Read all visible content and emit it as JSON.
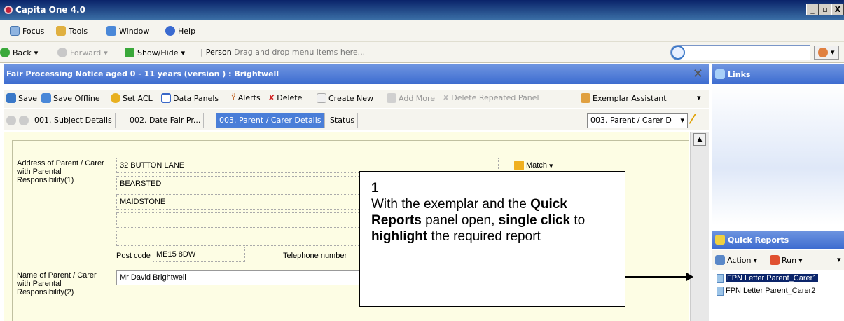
{
  "window": {
    "title": "Capita One 4.0",
    "min_btn": "_",
    "max_btn": "▫",
    "close_btn": "X"
  },
  "menubar": {
    "items": [
      {
        "label": "Focus",
        "icon": "focus-icon"
      },
      {
        "label": "Tools",
        "icon": "tools-icon"
      },
      {
        "label": "Window",
        "icon": "window-icon"
      },
      {
        "label": "Help",
        "icon": "help-icon"
      }
    ]
  },
  "navbar": {
    "back": "Back",
    "forward": "Forward",
    "show_hide": "Show/Hide",
    "person": "Person",
    "drag_hint": "Drag and drop menu items here...",
    "search_value": ""
  },
  "document": {
    "title": "Fair Processing Notice aged 0 - 11 years (version ) : Brightwell"
  },
  "toolbar": {
    "items": [
      "Save",
      "Save Offline",
      "Set ACL",
      "Data Panels",
      "Alerts",
      "Delete",
      "Create New",
      "Add More",
      "Delete Repeated Panel",
      "Exemplar Assistant"
    ]
  },
  "tabs": {
    "items": [
      "001. Subject Details",
      "002. Date Fair Pr...",
      "003. Parent / Carer Details",
      "Status"
    ],
    "select_value": "003. Parent / Carer D"
  },
  "form": {
    "address_label": "Address of Parent / Carer with Parental Responsibility(1)",
    "address_lines": [
      "32 BUTTON  LANE",
      "BEARSTED",
      "MAIDSTONE",
      "",
      ""
    ],
    "match_label": "Match",
    "postcode_label": "Post code",
    "postcode_value": "ME15  8DW",
    "telephone_label": "Telephone number",
    "name_label": "Name of Parent / Carer with Parental Responsibility(2)",
    "name_value": "Mr David Brightwell"
  },
  "links_panel": {
    "title": "Links"
  },
  "quick_reports": {
    "title": "Quick Reports",
    "action": "Action",
    "run": "Run",
    "reports": [
      "FPN Letter Parent_Carer1",
      "FPN Letter Parent_Carer2"
    ]
  },
  "callout": {
    "number": "1",
    "t1": "With the exemplar and the ",
    "b1": "Quick Reports",
    "t2": " panel open, ",
    "b2": "single click",
    "t3": " to ",
    "b3": "highlight",
    "t4": " the required report"
  }
}
